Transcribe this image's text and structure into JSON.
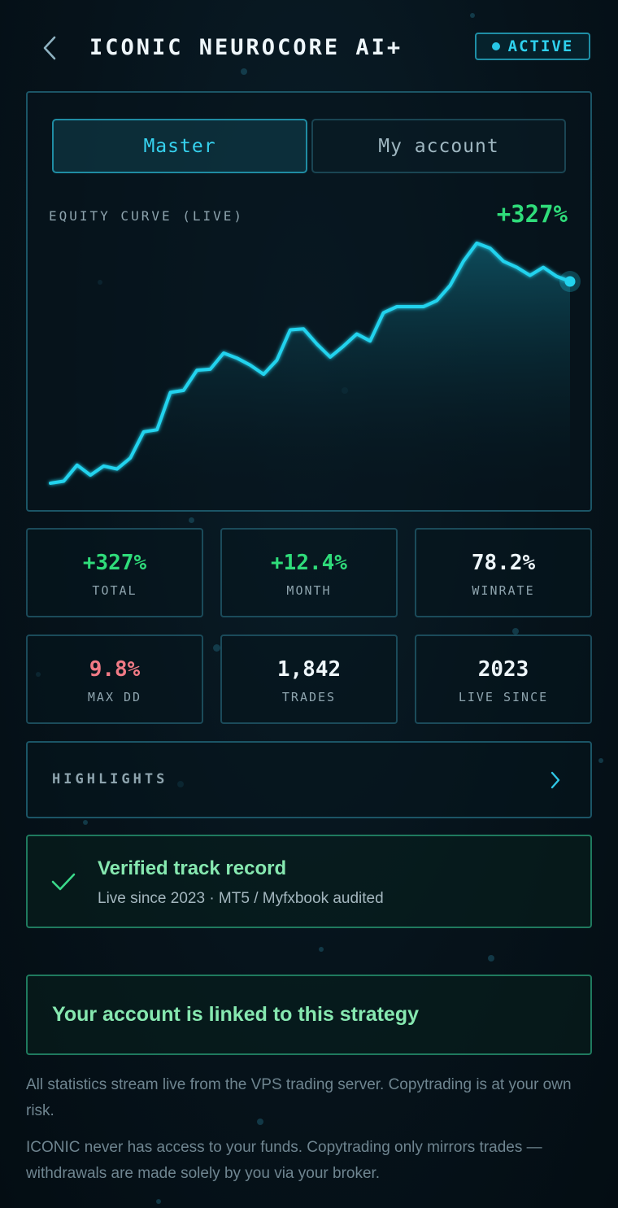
{
  "header": {
    "title": "ICONIC NEUROCORE AI+",
    "status": "ACTIVE",
    "back_icon": "chevron-left-icon"
  },
  "tabs": [
    {
      "label": "Master",
      "active": true
    },
    {
      "label": "My account",
      "active": false
    }
  ],
  "equity": {
    "label": "EQUITY CURVE (LIVE)",
    "value": "+327%"
  },
  "chart_data": {
    "type": "area",
    "title": "EQUITY CURVE (LIVE)",
    "xlabel": "",
    "ylabel": "",
    "grid": false,
    "x": [
      1,
      2,
      3,
      4,
      5,
      6,
      7,
      8,
      9,
      10,
      11,
      12,
      13,
      14,
      15,
      16,
      17,
      18,
      19,
      20,
      21,
      22,
      23,
      24,
      25,
      26,
      27,
      28,
      29,
      30,
      31,
      32,
      33,
      34,
      35,
      36,
      37,
      38,
      39,
      40
    ],
    "values": [
      0,
      2,
      18,
      8,
      17,
      14,
      25,
      51,
      53,
      90,
      92,
      112,
      113,
      129,
      124,
      117,
      108,
      122,
      152,
      153,
      138,
      125,
      136,
      148,
      141,
      169,
      175,
      175,
      175,
      181,
      196,
      220,
      238,
      233,
      220,
      214,
      206,
      214,
      205,
      200
    ],
    "ylim": [
      0,
      250
    ],
    "colors": {
      "line": "#22d3ee",
      "fill": "#0d4a5a"
    }
  },
  "stats": [
    {
      "value": "+327%",
      "label": "TOTAL",
      "color": "#2fdc7a"
    },
    {
      "value": "+12.4%",
      "label": "MONTH",
      "color": "#2fdc7a"
    },
    {
      "value": "78.2%",
      "label": "WINRATE",
      "color": "#eef6fa"
    },
    {
      "value": "9.8%",
      "label": "MAX DD",
      "color": "#f07a85"
    },
    {
      "value": "1,842",
      "label": "TRADES",
      "color": "#eef6fa"
    },
    {
      "value": "2023",
      "label": "LIVE SINCE",
      "color": "#eef6fa"
    }
  ],
  "highlights": {
    "label": "HIGHLIGHTS",
    "icon": "chevron-right-icon"
  },
  "verified": {
    "icon": "check-icon",
    "title": "Verified track record",
    "subtitle": "Live since 2023 · MT5 / Myfxbook audited"
  },
  "linked": {
    "text": "Your account is linked to this strategy"
  },
  "disclaimers": [
    "All statistics stream live from the VPS trading server. Copytrading is at your own risk.",
    "ICONIC never has access to your funds. Copytrading only mirrors trades — withdrawals are made solely by you via your broker."
  ],
  "colors": {
    "accent": "#22d3ee",
    "positive": "#2fdc7a",
    "negative": "#f07a85",
    "verified": "#86e8b0"
  }
}
